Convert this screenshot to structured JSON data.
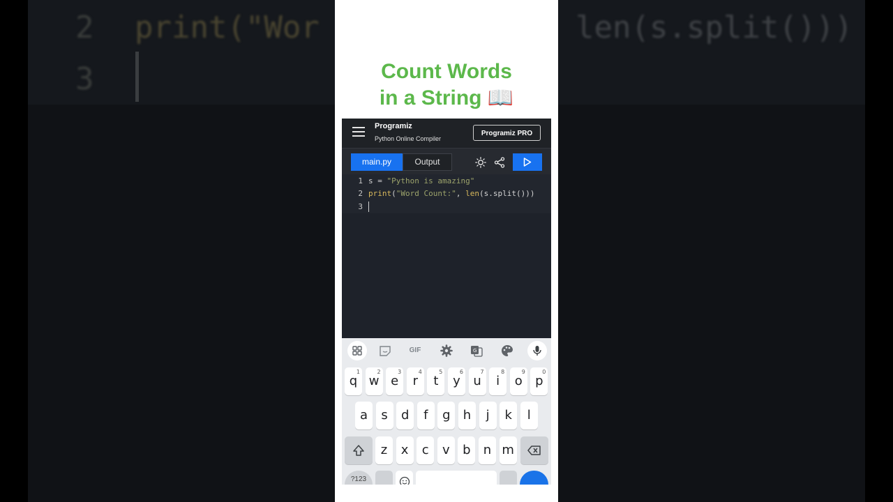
{
  "background": {
    "line_numbers": [
      "2",
      "3"
    ],
    "code_line2_start": "print(\"Wor",
    "code_line2_end": "len(s.split()))"
  },
  "title": {
    "line1": "Count Words",
    "line2": "in a String 📖"
  },
  "app": {
    "logo": "Programiz",
    "subtitle": "Python Online Compiler",
    "pro_button": "Programiz PRO",
    "tabs": [
      "main.py",
      "Output"
    ],
    "active_tab": "main.py",
    "accent_color": "#1872f0",
    "icons": [
      "menu-icon",
      "sun-icon",
      "share-icon",
      "run-icon"
    ]
  },
  "editor": {
    "line_numbers": [
      "1",
      "2",
      "3"
    ],
    "line1": {
      "var": "s",
      "op": " = ",
      "str": "\"Python is amazing\""
    },
    "line2": {
      "fn1": "print",
      "p1": "(",
      "str": "\"Word Count:\"",
      "mid": ", ",
      "fn2": "len",
      "rest": "(s.split()))"
    }
  },
  "keyboard": {
    "toolbar_icons": [
      "apps-grid-icon",
      "sticker-icon",
      "gif-icon",
      "settings-icon",
      "translate-icon",
      "palette-icon",
      "mic-icon"
    ],
    "gif_label": "GIF",
    "row1": [
      "q",
      "w",
      "e",
      "r",
      "t",
      "y",
      "u",
      "i",
      "o",
      "p"
    ],
    "row1_nums": [
      "1",
      "2",
      "3",
      "4",
      "5",
      "6",
      "7",
      "8",
      "9",
      "0"
    ],
    "row2": [
      "a",
      "s",
      "d",
      "f",
      "g",
      "h",
      "j",
      "k",
      "l"
    ],
    "row3": [
      "z",
      "x",
      "c",
      "v",
      "b",
      "n",
      "m"
    ],
    "symbols_key": "?123"
  }
}
